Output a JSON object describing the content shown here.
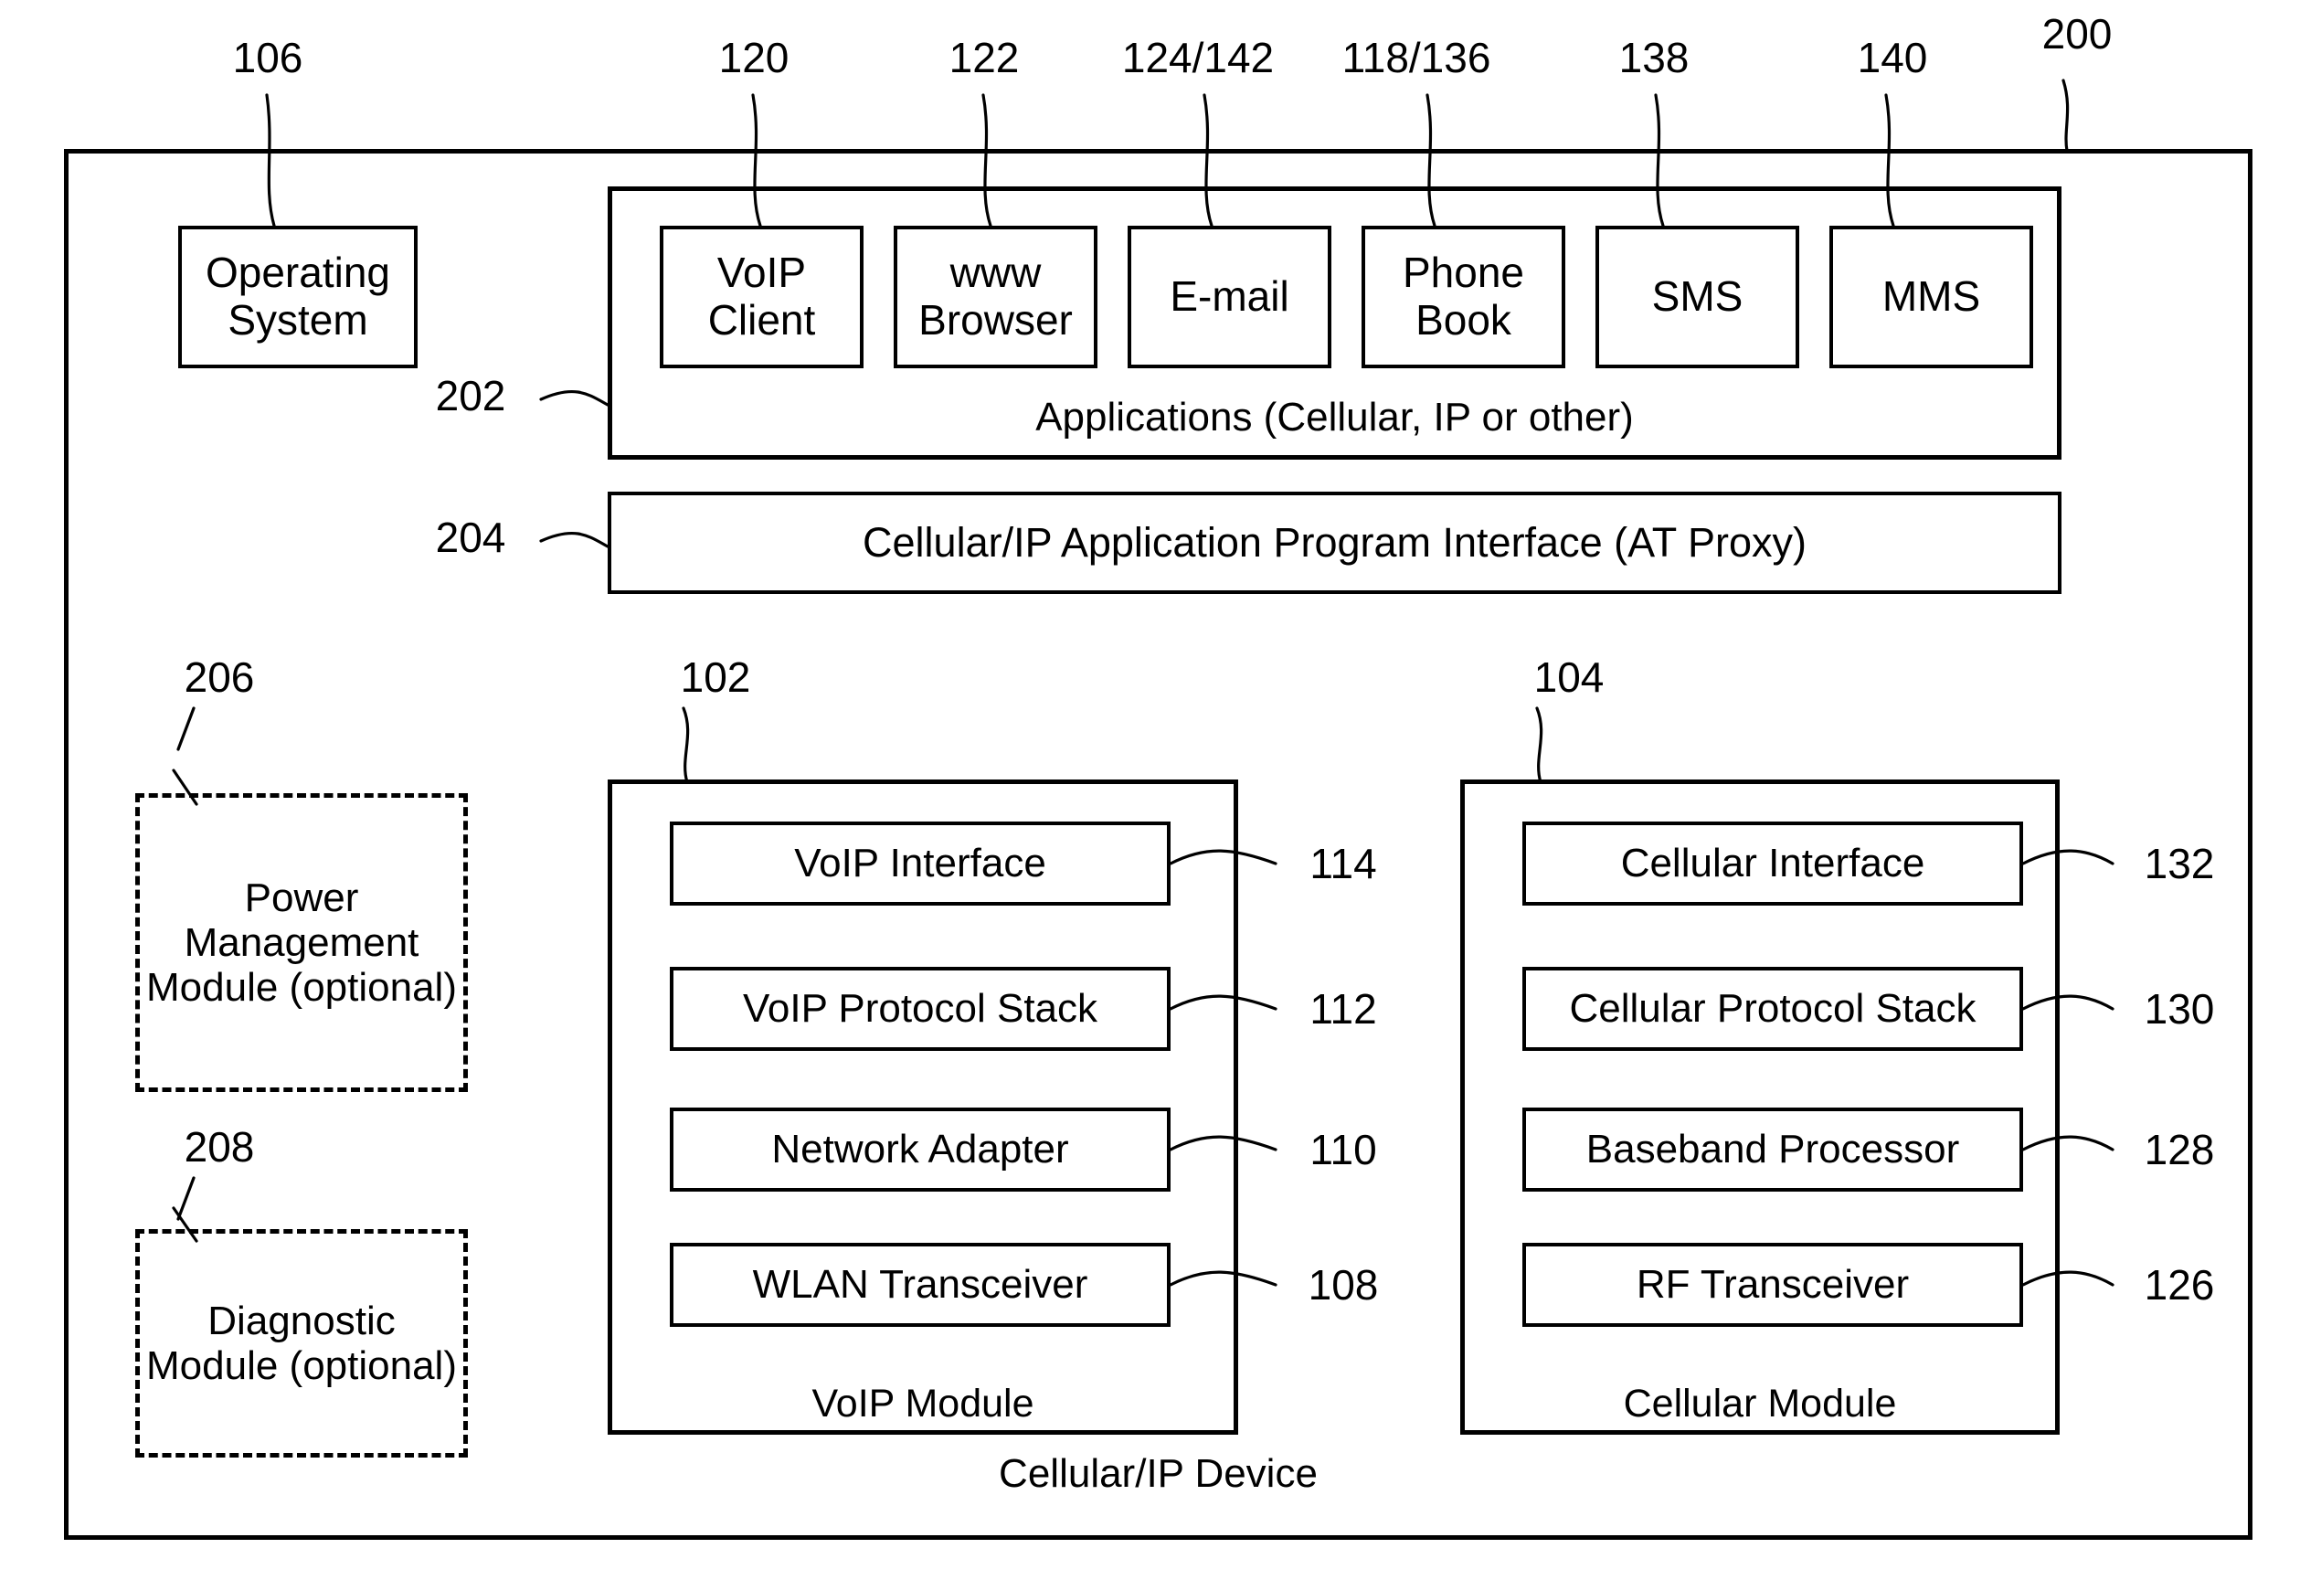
{
  "figure": {
    "device_caption": "Cellular/IP Device",
    "device_ref": "200",
    "os_box": {
      "label": "Operating\nSystem",
      "ref": "106"
    },
    "applications_panel": {
      "caption": "Applications (Cellular, IP or other)",
      "ref": "202",
      "items": [
        {
          "label": "VoIP\nClient",
          "ref": "120"
        },
        {
          "label": "www\nBrowser",
          "ref": "122"
        },
        {
          "label": "E-mail",
          "ref": "124/142"
        },
        {
          "label": "Phone\nBook",
          "ref": "118/136"
        },
        {
          "label": "SMS",
          "ref": "138"
        },
        {
          "label": "MMS",
          "ref": "140"
        }
      ]
    },
    "api_bar": {
      "label": "Cellular/IP Application Program Interface (AT Proxy)",
      "ref": "204"
    },
    "optional_modules": [
      {
        "label": "Power\nManagement\nModule\n(optional)",
        "ref": "206"
      },
      {
        "label": "Diagnostic\nModule\n(optional)",
        "ref": "208"
      }
    ],
    "voip_module": {
      "caption": "VoIP Module",
      "ref": "102",
      "rows": [
        {
          "label": "VoIP Interface",
          "ref": "114"
        },
        {
          "label": "VoIP Protocol Stack",
          "ref": "112"
        },
        {
          "label": "Network Adapter",
          "ref": "110"
        },
        {
          "label": "WLAN Transceiver",
          "ref": "108"
        }
      ]
    },
    "cellular_module": {
      "caption": "Cellular Module",
      "ref": "104",
      "rows": [
        {
          "label": "Cellular Interface",
          "ref": "132"
        },
        {
          "label": "Cellular Protocol Stack",
          "ref": "130"
        },
        {
          "label": "Baseband Processor",
          "ref": "128"
        },
        {
          "label": "RF Transceiver",
          "ref": "126"
        }
      ]
    },
    "colors": {
      "line": "#000000",
      "background": "#ffffff"
    }
  }
}
